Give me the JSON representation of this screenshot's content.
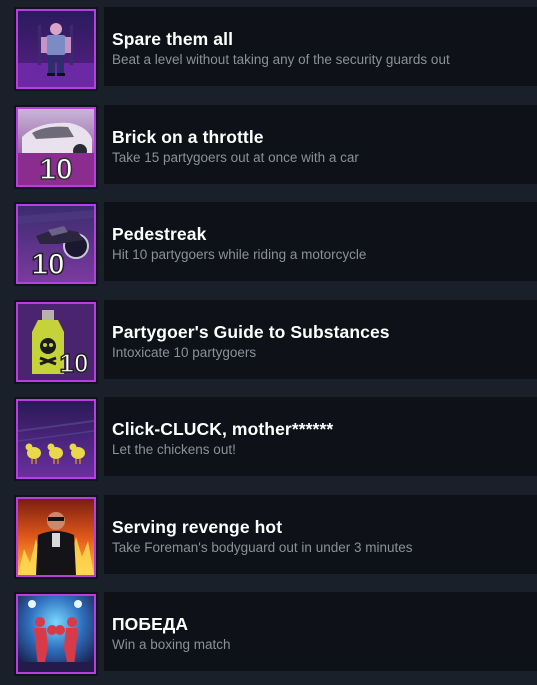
{
  "achievements": [
    {
      "title": "Spare them all",
      "description": "Beat a level without taking any of the security guards out",
      "icon": "security-guard-icon"
    },
    {
      "title": "Brick on a throttle",
      "description": "Take 15 partygoers out at once with a car",
      "icon": "car-10-icon"
    },
    {
      "title": "Pedestreak",
      "description": "Hit 10 partygoers while riding a motorcycle",
      "icon": "motorcycle-10-icon"
    },
    {
      "title": "Partygoer's Guide to Substances",
      "description": "Intoxicate 10 partygoers",
      "icon": "poison-bottle-10-icon"
    },
    {
      "title": "Click-CLUCK, mother******",
      "description": "Let the chickens out!",
      "icon": "chickens-icon"
    },
    {
      "title": "Serving revenge hot",
      "description": "Take Foreman's bodyguard out in under 3 minutes",
      "icon": "bodyguard-fire-icon"
    },
    {
      "title": "ПОБЕДА",
      "description": "Win a boxing match",
      "icon": "boxing-match-icon"
    }
  ],
  "icon_badges": {
    "car": "10",
    "motorcycle": "10",
    "bottle": "10"
  },
  "colors": {
    "background": "#1a2029",
    "row": "#0e1218",
    "frame": "#b93de0",
    "title": "#ffffff",
    "description": "#8b9097"
  }
}
